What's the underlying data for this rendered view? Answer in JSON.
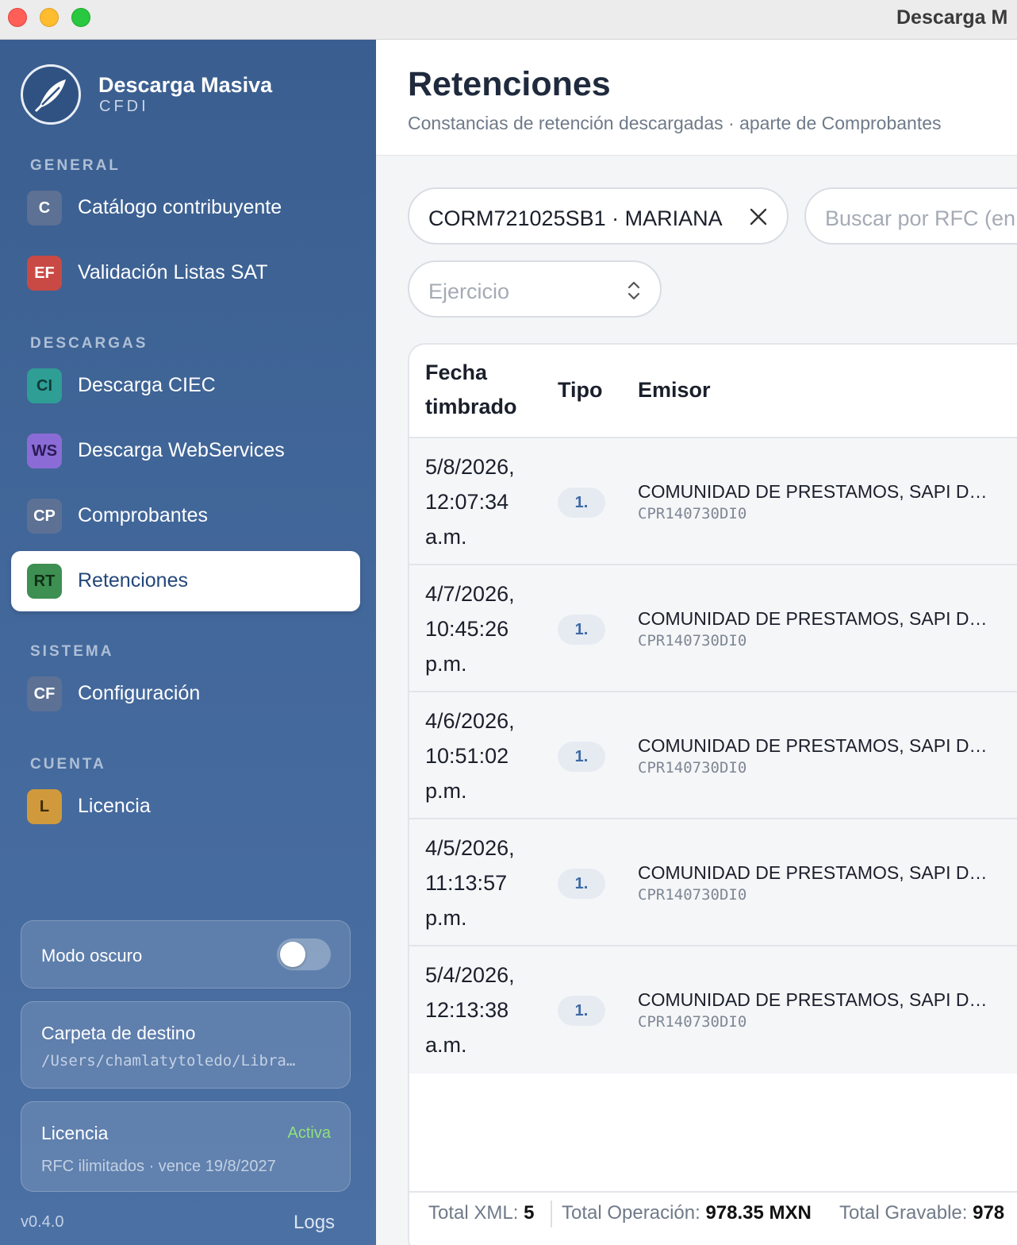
{
  "window": {
    "title": "Descarga M"
  },
  "brand": {
    "title": "Descarga Masiva",
    "subtitle": "CFDI"
  },
  "sidebar": {
    "sections": [
      "GENERAL",
      "DESCARGAS",
      "SISTEMA",
      "CUENTA"
    ],
    "items": [
      {
        "badge": "C",
        "label": "Catálogo contribuyente",
        "color": "#5c7194"
      },
      {
        "badge": "EF",
        "label": "Validación Listas SAT",
        "color": "#c94a45"
      },
      {
        "badge": "CI",
        "label": "Descarga CIEC",
        "color": "#2f9e95"
      },
      {
        "badge": "WS",
        "label": "Descarga WebServices",
        "color": "#8b6cd6"
      },
      {
        "badge": "CP",
        "label": "Comprobantes",
        "color": "#5c7194"
      },
      {
        "badge": "RT",
        "label": "Retenciones",
        "color": "#3e8f52"
      },
      {
        "badge": "CF",
        "label": "Configuración",
        "color": "#5c7194"
      },
      {
        "badge": "L",
        "label": "Licencia",
        "color": "#d09a3c"
      }
    ],
    "dark_mode": {
      "label": "Modo oscuro",
      "on": false
    },
    "dest_folder": {
      "title": "Carpeta de destino",
      "path": "/Users/chamlatytoledo/Libra…"
    },
    "license": {
      "title": "Licencia",
      "status": "Activa",
      "detail": "RFC ilimitados · vence 19/8/2027"
    },
    "version": "v0.4.0",
    "logs_label": "Logs"
  },
  "main": {
    "title": "Retenciones",
    "subtitle": "Constancias de retención descargadas · aparte de Comprobantes",
    "filters": {
      "rfc_selected": "CORM721025SB1 · MARIANA",
      "search_placeholder": "Buscar por RFC (en",
      "ejercicio_placeholder": "Ejercicio"
    },
    "table": {
      "headers": {
        "fecha": "Fecha timbrado",
        "tipo": "Tipo",
        "emisor": "Emisor"
      },
      "rows": [
        {
          "fecha": "5/8/2026, 12:07:34 a.m.",
          "tipo": "1.",
          "emisor": "COMUNIDAD DE PRESTAMOS, SAPI D…",
          "rfc": "CPR140730DI0"
        },
        {
          "fecha": "4/7/2026, 10:45:26 p.m.",
          "tipo": "1.",
          "emisor": "COMUNIDAD DE PRESTAMOS, SAPI D…",
          "rfc": "CPR140730DI0"
        },
        {
          "fecha": "4/6/2026, 10:51:02 p.m.",
          "tipo": "1.",
          "emisor": "COMUNIDAD DE PRESTAMOS, SAPI D…",
          "rfc": "CPR140730DI0"
        },
        {
          "fecha": "4/5/2026, 11:13:57 p.m.",
          "tipo": "1.",
          "emisor": "COMUNIDAD DE PRESTAMOS, SAPI D…",
          "rfc": "CPR140730DI0"
        },
        {
          "fecha": "5/4/2026, 12:13:38 a.m.",
          "tipo": "1.",
          "emisor": "COMUNIDAD DE PRESTAMOS, SAPI D…",
          "rfc": "CPR140730DI0"
        }
      ]
    },
    "totals": {
      "xml_label": "Total XML:",
      "xml_value": "5",
      "operacion_label": "Total Operación:",
      "operacion_value": "978.35 MXN",
      "gravable_label": "Total Gravable:",
      "gravable_value": "978"
    }
  }
}
